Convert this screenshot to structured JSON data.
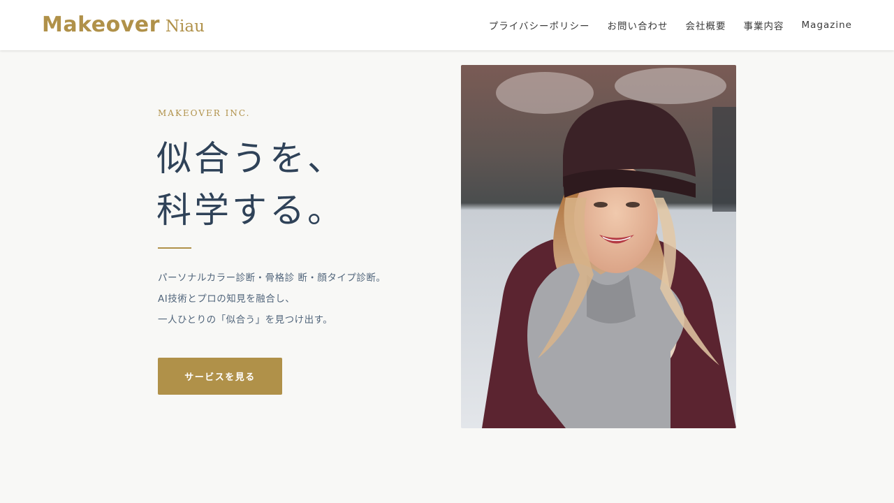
{
  "header": {
    "logo_main": "Makeover",
    "logo_sub": "Niau",
    "nav": [
      {
        "label": "プライバシーポリシー"
      },
      {
        "label": "お問い合わせ"
      },
      {
        "label": "会社概要"
      },
      {
        "label": "事業内容"
      },
      {
        "label": "Magazine"
      }
    ]
  },
  "hero": {
    "eyebrow": "MAKEOVER INC.",
    "headline_line1": "似合うを、",
    "headline_line2": "科学する。",
    "description": [
      "パーソナルカラー診断・骨格診 断・顔タイプ診断。",
      "AI技術とプロの知見を融合し、",
      "一人ひとりの「似合う」を見つけ出す。"
    ],
    "cta_label": "サービスを見る"
  },
  "colors": {
    "accent": "#b09149",
    "heading": "#2f4258",
    "body_text": "#51657b",
    "background": "#f8f8f6"
  }
}
